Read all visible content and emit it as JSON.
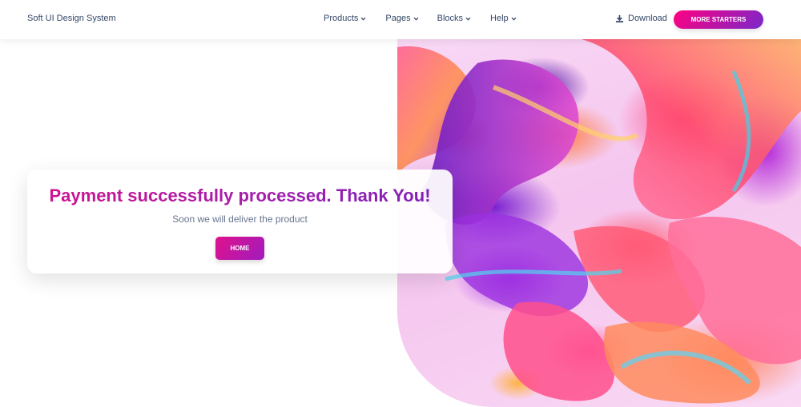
{
  "navbar": {
    "brand": "Soft UI Design System",
    "links": [
      {
        "label": "Products"
      },
      {
        "label": "Pages"
      },
      {
        "label": "Blocks"
      },
      {
        "label": "Help"
      }
    ],
    "download_label": "Download",
    "cta_label": "MORE STARTERS"
  },
  "card": {
    "title": "Payment successfully processed. Thank You!",
    "subtitle": "Soon we will deliver the product",
    "button_label": "HOME"
  },
  "colors": {
    "text": "#344767",
    "muted": "#67748e",
    "gradient_start": "#ff0080",
    "gradient_end": "#7928ca"
  },
  "icons": {
    "chevron": "chevron-down-icon",
    "download": "download-icon"
  }
}
